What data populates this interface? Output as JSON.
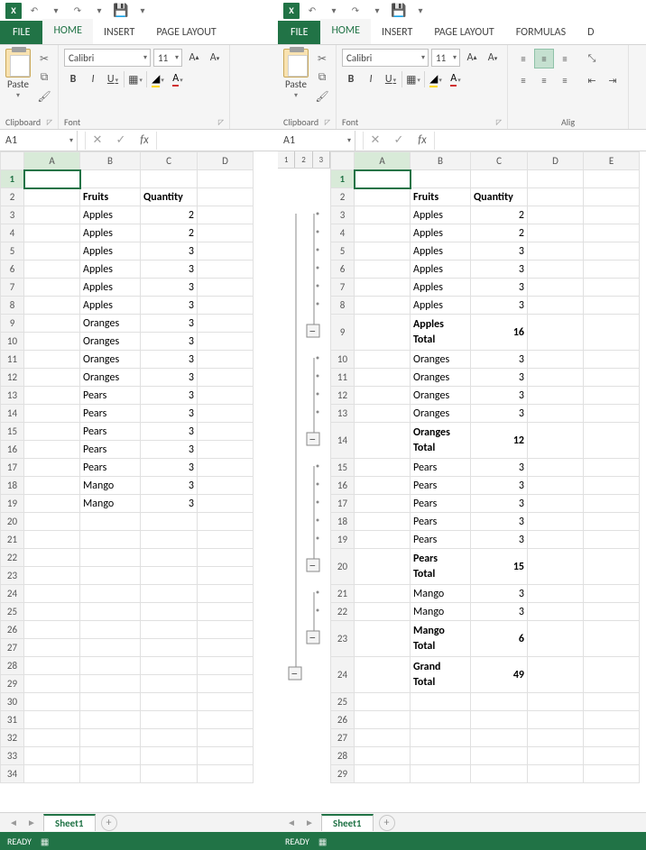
{
  "qat": {
    "undo": "↶",
    "redo": "↷",
    "save": "💾"
  },
  "tabs": {
    "file": "FILE",
    "home": "HOME",
    "insert": "INSERT",
    "page_layout": "PAGE LAYOUT",
    "formulas": "FORMULAS",
    "data_initial": "D"
  },
  "ribbon": {
    "clipboard": {
      "title": "Clipboard",
      "paste": "Paste"
    },
    "font": {
      "title": "Font",
      "font_name": "Calibri",
      "font_size": "11",
      "bold": "B",
      "italic": "I",
      "underline": "U",
      "increase": "A",
      "decrease": "A"
    },
    "alignment": {
      "title": "Alig"
    }
  },
  "namebox": "A1",
  "fx_cancel": "✕",
  "fx_enter": "✓",
  "fx_label": "fx",
  "outline_levels": [
    "1",
    "2",
    "3"
  ],
  "left": {
    "columns": [
      "A",
      "B",
      "C",
      "D"
    ],
    "rows_count": 34,
    "selected_cell": "A1",
    "data": {
      "r2": {
        "B": {
          "v": "Fruits",
          "b": true
        },
        "C": {
          "v": "Quantity",
          "b": true
        }
      },
      "r3": {
        "B": {
          "v": "Apples"
        },
        "C": {
          "v": "2",
          "n": true
        }
      },
      "r4": {
        "B": {
          "v": "Apples"
        },
        "C": {
          "v": "2",
          "n": true
        }
      },
      "r5": {
        "B": {
          "v": "Apples"
        },
        "C": {
          "v": "3",
          "n": true
        }
      },
      "r6": {
        "B": {
          "v": "Apples"
        },
        "C": {
          "v": "3",
          "n": true
        }
      },
      "r7": {
        "B": {
          "v": "Apples"
        },
        "C": {
          "v": "3",
          "n": true
        }
      },
      "r8": {
        "B": {
          "v": "Apples"
        },
        "C": {
          "v": "3",
          "n": true
        }
      },
      "r9": {
        "B": {
          "v": "Oranges"
        },
        "C": {
          "v": "3",
          "n": true
        }
      },
      "r10": {
        "B": {
          "v": "Oranges"
        },
        "C": {
          "v": "3",
          "n": true
        }
      },
      "r11": {
        "B": {
          "v": "Oranges"
        },
        "C": {
          "v": "3",
          "n": true
        }
      },
      "r12": {
        "B": {
          "v": "Oranges"
        },
        "C": {
          "v": "3",
          "n": true
        }
      },
      "r13": {
        "B": {
          "v": "Pears"
        },
        "C": {
          "v": "3",
          "n": true
        }
      },
      "r14": {
        "B": {
          "v": "Pears"
        },
        "C": {
          "v": "3",
          "n": true
        }
      },
      "r15": {
        "B": {
          "v": "Pears"
        },
        "C": {
          "v": "3",
          "n": true
        }
      },
      "r16": {
        "B": {
          "v": "Pears"
        },
        "C": {
          "v": "3",
          "n": true
        }
      },
      "r17": {
        "B": {
          "v": "Pears"
        },
        "C": {
          "v": "3",
          "n": true
        }
      },
      "r18": {
        "B": {
          "v": "Mango"
        },
        "C": {
          "v": "3",
          "n": true
        }
      },
      "r19": {
        "B": {
          "v": "Mango"
        },
        "C": {
          "v": "3",
          "n": true
        }
      }
    }
  },
  "right": {
    "columns": [
      "A",
      "B",
      "C",
      "D",
      "E"
    ],
    "rows_count": 29,
    "selected_cell": "A1",
    "data": {
      "r2": {
        "B": {
          "v": "Fruits",
          "b": true
        },
        "C": {
          "v": "Quantity",
          "b": true
        }
      },
      "r3": {
        "B": {
          "v": "Apples"
        },
        "C": {
          "v": "2",
          "n": true
        }
      },
      "r4": {
        "B": {
          "v": "Apples"
        },
        "C": {
          "v": "2",
          "n": true
        }
      },
      "r5": {
        "B": {
          "v": "Apples"
        },
        "C": {
          "v": "3",
          "n": true
        }
      },
      "r6": {
        "B": {
          "v": "Apples"
        },
        "C": {
          "v": "3",
          "n": true
        }
      },
      "r7": {
        "B": {
          "v": "Apples"
        },
        "C": {
          "v": "3",
          "n": true
        }
      },
      "r8": {
        "B": {
          "v": "Apples"
        },
        "C": {
          "v": "3",
          "n": true
        }
      },
      "r9": {
        "B": {
          "v": "Apples Total",
          "b": true
        },
        "C": {
          "v": "16",
          "n": true,
          "b": true
        }
      },
      "r10": {
        "B": {
          "v": "Oranges"
        },
        "C": {
          "v": "3",
          "n": true
        }
      },
      "r11": {
        "B": {
          "v": "Oranges"
        },
        "C": {
          "v": "3",
          "n": true
        }
      },
      "r12": {
        "B": {
          "v": "Oranges"
        },
        "C": {
          "v": "3",
          "n": true
        }
      },
      "r13": {
        "B": {
          "v": "Oranges"
        },
        "C": {
          "v": "3",
          "n": true
        }
      },
      "r14": {
        "B": {
          "v": "Oranges Total",
          "b": true
        },
        "C": {
          "v": "12",
          "n": true,
          "b": true
        }
      },
      "r15": {
        "B": {
          "v": "Pears"
        },
        "C": {
          "v": "3",
          "n": true
        }
      },
      "r16": {
        "B": {
          "v": "Pears"
        },
        "C": {
          "v": "3",
          "n": true
        }
      },
      "r17": {
        "B": {
          "v": "Pears"
        },
        "C": {
          "v": "3",
          "n": true
        }
      },
      "r18": {
        "B": {
          "v": "Pears"
        },
        "C": {
          "v": "3",
          "n": true
        }
      },
      "r19": {
        "B": {
          "v": "Pears"
        },
        "C": {
          "v": "3",
          "n": true
        }
      },
      "r20": {
        "B": {
          "v": "Pears Total",
          "b": true
        },
        "C": {
          "v": "15",
          "n": true,
          "b": true
        }
      },
      "r21": {
        "B": {
          "v": "Mango"
        },
        "C": {
          "v": "3",
          "n": true
        }
      },
      "r22": {
        "B": {
          "v": "Mango"
        },
        "C": {
          "v": "3",
          "n": true
        }
      },
      "r23": {
        "B": {
          "v": "Mango Total",
          "b": true
        },
        "C": {
          "v": "6",
          "n": true,
          "b": true
        }
      },
      "r24": {
        "B": {
          "v": "Grand Total",
          "b": true
        },
        "C": {
          "v": "49",
          "n": true,
          "b": true
        }
      }
    },
    "outline_groups": [
      {
        "detail_from": 3,
        "detail_to": 8,
        "summary": 9
      },
      {
        "detail_from": 10,
        "detail_to": 13,
        "summary": 14
      },
      {
        "detail_from": 15,
        "detail_to": 19,
        "summary": 20
      },
      {
        "detail_from": 21,
        "detail_to": 22,
        "summary": 23
      }
    ],
    "outline_grand_summary": 24
  },
  "sheet_tab": "Sheet1",
  "status": {
    "ready": "READY"
  }
}
